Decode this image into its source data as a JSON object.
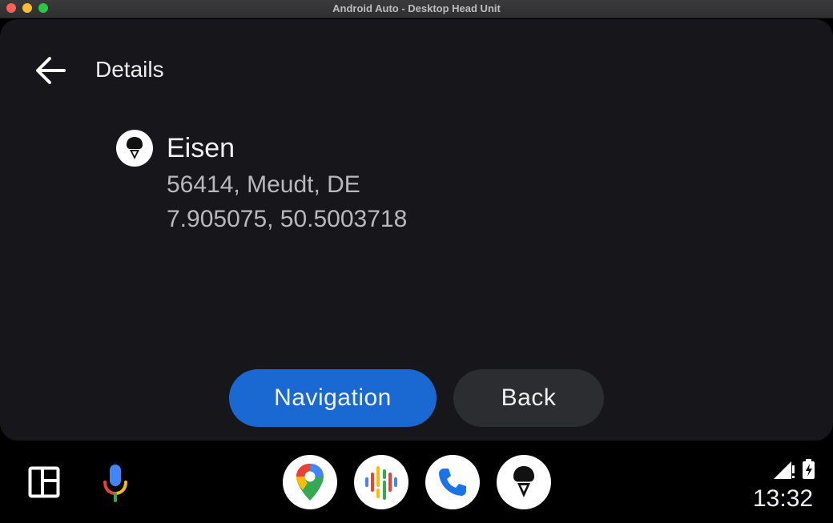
{
  "window": {
    "title": "Android Auto - Desktop Head Unit"
  },
  "header": {
    "title": "Details",
    "back_icon": "arrow-back-icon"
  },
  "place": {
    "icon": "ice-cream-icon",
    "name": "Eisen",
    "address": "56414, Meudt, DE",
    "coordinates": "7.905075, 50.5003718"
  },
  "actions": {
    "primary_label": "Navigation",
    "secondary_label": "Back"
  },
  "rail": {
    "dashboard_icon": "dashboard-icon",
    "mic_icon": "microphone-icon",
    "apps": [
      {
        "name": "Google Maps",
        "icon": "maps-icon"
      },
      {
        "name": "Podcasts",
        "icon": "podcasts-icon"
      },
      {
        "name": "Phone",
        "icon": "phone-icon"
      },
      {
        "name": "Ice cream app",
        "icon": "ice-cream-icon"
      }
    ],
    "time": "13:32"
  },
  "colors": {
    "primary_button": "#1a68d1",
    "secondary_button": "#2c2d30",
    "card_background": "#17171b"
  }
}
